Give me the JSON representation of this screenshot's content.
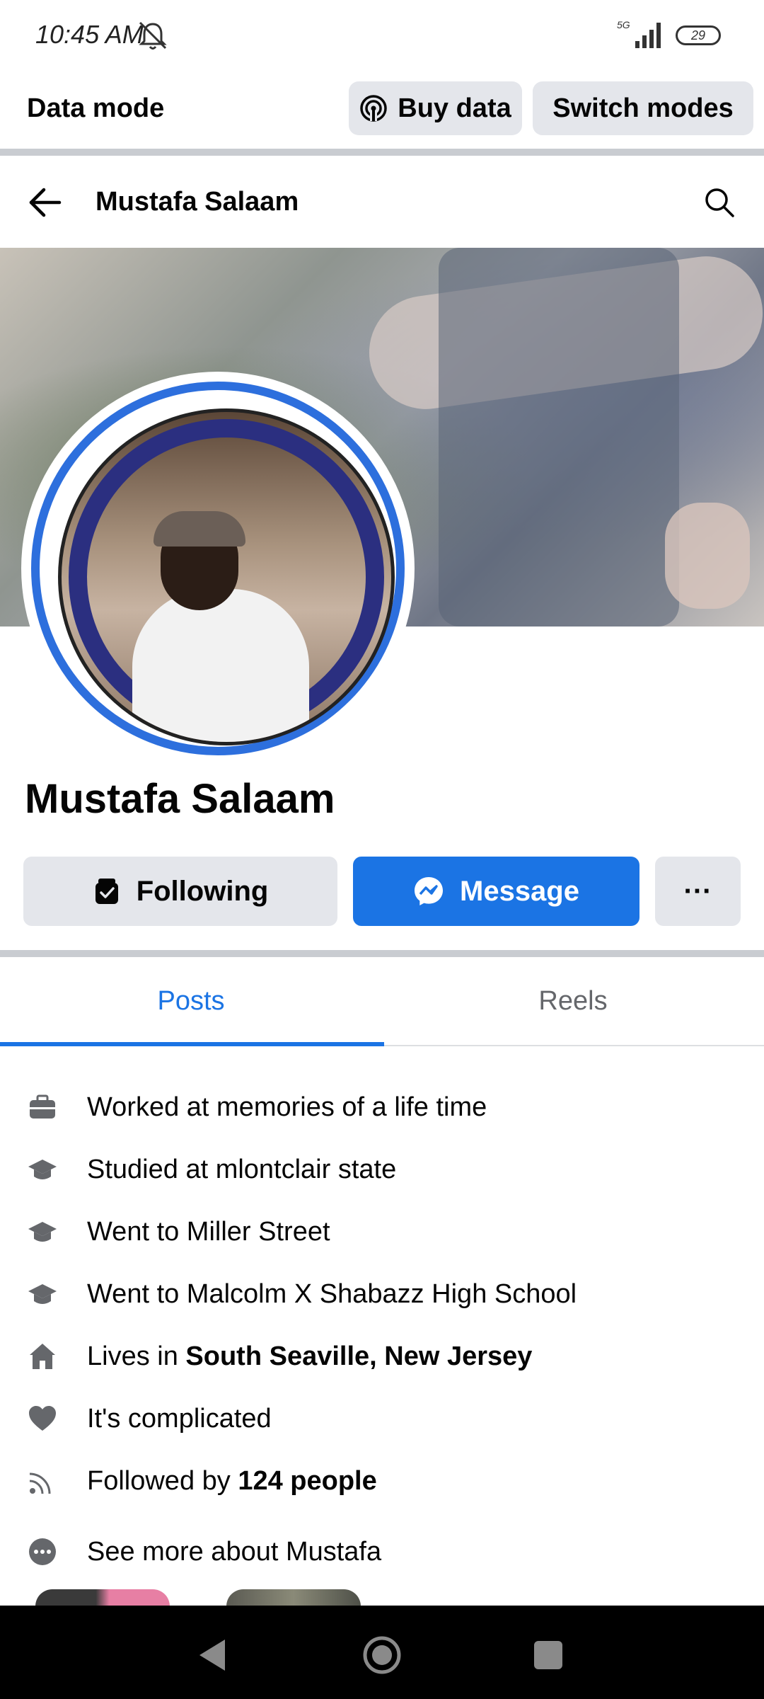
{
  "status_bar": {
    "time": "10:45 AM",
    "network": "5G",
    "battery": "29"
  },
  "data_mode": {
    "label": "Data mode",
    "buy_data_label": "Buy data",
    "switch_modes_label": "Switch modes"
  },
  "header": {
    "title": "Mustafa Salaam"
  },
  "profile": {
    "name": "Mustafa Salaam",
    "following_label": "Following",
    "message_label": "Message",
    "more_label": "···"
  },
  "tabs": [
    {
      "label": "Posts",
      "active": true
    },
    {
      "label": "Reels",
      "active": false
    }
  ],
  "intro": {
    "work": "Worked at memories of a life time",
    "study": "Studied at mlontclair  state",
    "school1": "Went to Miller Street",
    "school2": "Went to Malcolm X Shabazz High School",
    "lives_prefix": "Lives in ",
    "lives_place": "South Seaville, New Jersey",
    "relationship": "It's complicated",
    "followed_prefix": "Followed by ",
    "followed_count": "124 people",
    "see_more": "See more about Mustafa"
  },
  "colors": {
    "accent": "#1b74e4",
    "button_gray": "#e4e6eb",
    "icon_gray": "#65676b"
  }
}
